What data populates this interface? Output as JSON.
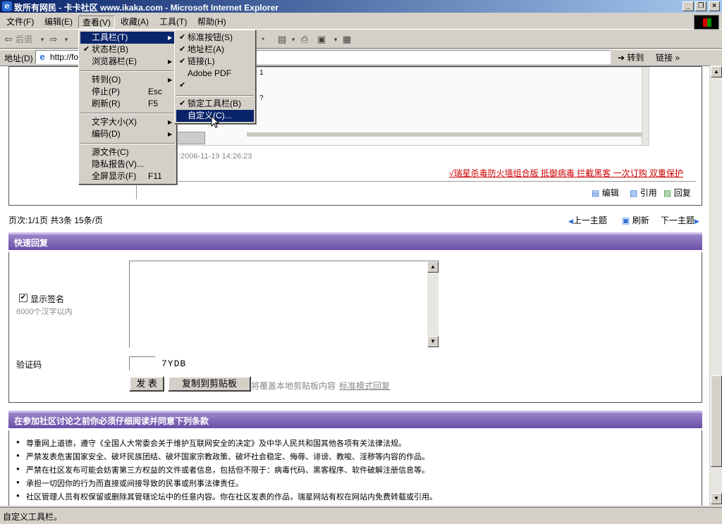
{
  "window": {
    "title": "致所有网民 - 卡卡社区 www.ikaka.com - Microsoft Internet Explorer",
    "controls": [
      "_",
      "❐",
      "×"
    ]
  },
  "menubar": [
    {
      "label": "文件(F)"
    },
    {
      "label": "编辑(E)"
    },
    {
      "label": "查看(V)"
    },
    {
      "label": "收藏(A)"
    },
    {
      "label": "工具(T)"
    },
    {
      "label": "帮助(H)"
    }
  ],
  "toolbar": {
    "back_label": "后退"
  },
  "address": {
    "label": "地址(D)",
    "url": "http://fo",
    "go_label": "转到",
    "links_label": "链接"
  },
  "view_menu": {
    "items": [
      {
        "label": "工具栏(T)",
        "arrow": "▶"
      },
      {
        "label": "状态栏(B)",
        "check": "✔"
      },
      {
        "label": "浏览器栏(E)",
        "arrow": "▶"
      },
      {
        "label": "转到(O)",
        "arrow": "▶"
      },
      {
        "label": "停止(P)",
        "accel": "Esc"
      },
      {
        "label": "刷新(R)",
        "accel": "F5"
      },
      {
        "label": "文字大小(X)",
        "arrow": "▶"
      },
      {
        "label": "编码(D)",
        "arrow": "▶"
      },
      {
        "label": "源文件(C)"
      },
      {
        "label": "隐私报告(V)..."
      },
      {
        "label": "全屏显示(F)",
        "accel": "F11"
      }
    ]
  },
  "toolbar_submenu": {
    "items": [
      {
        "label": "标准按钮(S)",
        "check": "✔"
      },
      {
        "label": "地址栏(A)",
        "check": "✔"
      },
      {
        "label": "链接(L)",
        "check": "✔"
      },
      {
        "label": "Adobe PDF",
        "check": ""
      },
      {
        "label": "",
        "check": "✔"
      },
      {
        "label": "锁定工具栏(B)",
        "check": "✔"
      },
      {
        "label": "自定义(C)..."
      }
    ]
  },
  "post": {
    "timestamp": ":2006-11-19 14:26:23",
    "ad_link": "√瑞星杀毒防火墙组合版 抵御病毒 拦截黑客 一次订购 双重保护",
    "actions": [
      "编辑",
      "引用",
      "回复"
    ],
    "embedded_fragments": [
      "1",
      "?"
    ]
  },
  "pagination": {
    "info": "页次:1/1页 共3条 15条/页",
    "prev": "上一主题",
    "refresh": "刷新",
    "next": "下一主题"
  },
  "quick_reply": {
    "title": "快速回复",
    "show_signature": "显示签名",
    "limit_note": "6000个汉字以内",
    "captcha_label": "验证码",
    "captcha_code": "7YDB",
    "submit": "发 表",
    "copy_button": "复制到剪贴板",
    "copy_note": "将覆盖本地剪贴板内容",
    "standard_mode": "标准模式回复"
  },
  "rules": {
    "title": "在参加社区讨论之前你必须仔细阅读并同意下列条款",
    "items": [
      "尊重网上道德，遵守《全国人大常委会关于维护互联网安全的决定》及中华人民共和国其他各项有关法律法规。",
      "严禁发表危害国家安全、破坏民族团结、破坏国家宗教政策、破坏社会稳定、侮辱、诽谤、教唆、淫秽等内容的作品。",
      "严禁在社区发布可能会妨害第三方权益的文件或者信息，包括但不限于：病毒代码、黑客程序、软件破解注册信息等。",
      "承担一切因你的行为而直接或间接导致的民事或刑事法律责任。",
      "社区管理人员有权保留或删除其管辖论坛中的任意内容。你在社区发表的作品，瑞星网站有权在网站内免费转载或引用。"
    ]
  },
  "status": {
    "text": "自定义工具栏。"
  },
  "colors": {
    "title_bar": "#0a246a",
    "menu_highlight": "#0a246a",
    "section_header": "#6a4ea8",
    "ad_link": "#cc0000"
  }
}
